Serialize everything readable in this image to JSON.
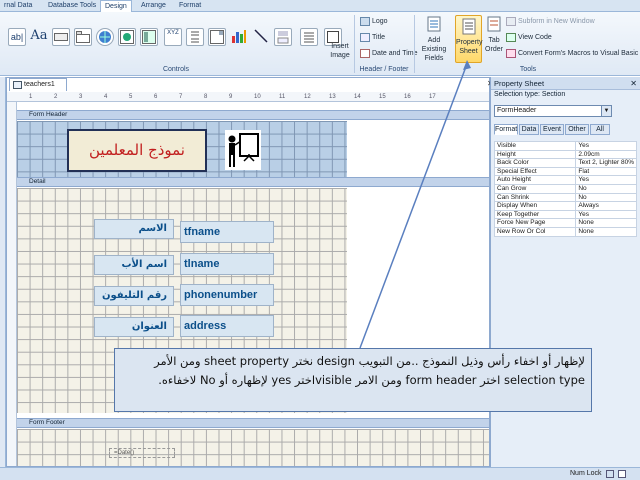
{
  "ribbon_tabs": [
    "rnal Data",
    "Database Tools",
    "Design",
    "Arrange",
    "Format"
  ],
  "ribbon": {
    "controls_icons": [
      "text-box-icon",
      "label-icon",
      "button-icon",
      "tab-control-icon",
      "hyperlink-icon",
      "web-browser-icon",
      "navigation-icon",
      "option-group-icon",
      "page-break-icon",
      "combo-box-icon",
      "chart-icon",
      "line-icon",
      "toggle-icon",
      "list-box-icon",
      "rectangle-icon"
    ],
    "controls_text": {
      "label": "Aa",
      "xyz": "XYZ"
    },
    "insert_image": "Insert Image",
    "logo": "Logo",
    "title": "Title",
    "date_time": "Date and Time",
    "add_existing": "Add Existing Fields",
    "property_sheet": "Property Sheet",
    "tab_order": "Tab Order",
    "subform_new_window": "Subform in New Window",
    "view_code": "View Code",
    "convert_macros": "Convert Form's Macros to Visual Basic",
    "groups": {
      "controls": "Controls",
      "header_footer": "Header / Footer",
      "tools": "Tools"
    }
  },
  "form": {
    "tab_title": "teachers1",
    "sections": {
      "header": "Form Header",
      "detail": "Detail",
      "footer": "Form Footer"
    },
    "header_title": "نموذج المعلمين",
    "fields": [
      {
        "label": "الاسم",
        "control": "tfname"
      },
      {
        "label": "اسم الأب",
        "control": "tlname"
      },
      {
        "label": "رقم التليفون",
        "control": "phonenumber"
      },
      {
        "label": "العنوان",
        "control": "address"
      }
    ],
    "date_placeholder": "=Date()"
  },
  "callout": "لإظهار أو اخفاء رأس وذيل النموذج ..من التبويب design نختر sheet property ومن الأمر selection type اختر form header ومن الامر visibleاختر yes لإظهاره أو No لاخفاءه.",
  "property_sheet": {
    "title": "Property Sheet",
    "selection_type": "Selection type:  Section",
    "selected": "FormHeader",
    "tabs": [
      "Format",
      "Data",
      "Event",
      "Other",
      "All"
    ],
    "rows": [
      {
        "k": "Visible",
        "v": "Yes"
      },
      {
        "k": "Height",
        "v": "2.09cm"
      },
      {
        "k": "Back Color",
        "v": "Text 2, Lighter 80%"
      },
      {
        "k": "Special Effect",
        "v": "Flat"
      },
      {
        "k": "Auto Height",
        "v": "Yes"
      },
      {
        "k": "Can Grow",
        "v": "No"
      },
      {
        "k": "Can Shrink",
        "v": "No"
      },
      {
        "k": "Display When",
        "v": "Always"
      },
      {
        "k": "Keep Together",
        "v": "Yes"
      },
      {
        "k": "Force New Page",
        "v": "None"
      },
      {
        "k": "New Row Or Col",
        "v": "None"
      }
    ]
  },
  "status": {
    "num_lock": "Num Lock"
  },
  "ruler_ticks": [
    "1",
    "2",
    "3",
    "4",
    "5",
    "6",
    "7",
    "8",
    "9",
    "10",
    "11",
    "12",
    "13",
    "14",
    "15",
    "16",
    "17"
  ]
}
